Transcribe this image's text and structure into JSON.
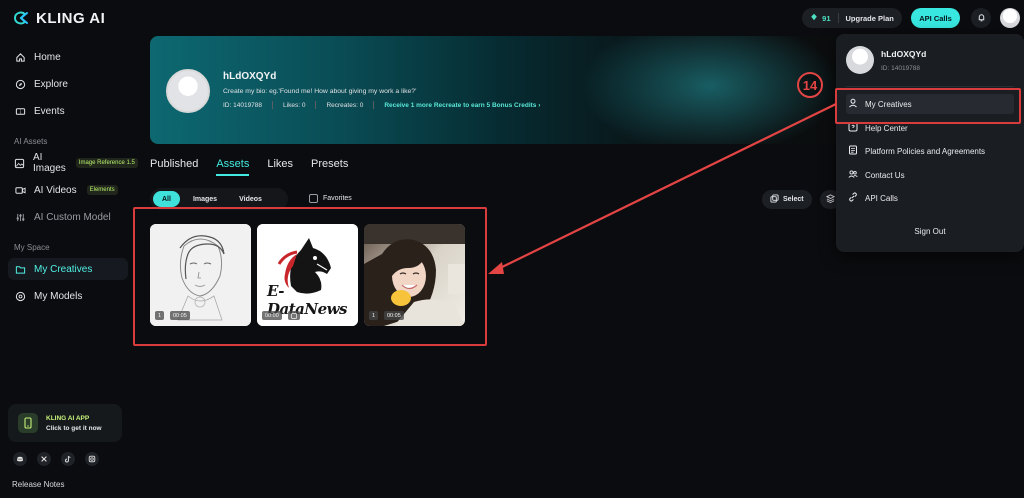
{
  "brand": {
    "name": "KLING AI"
  },
  "sidebar": {
    "items": [
      {
        "label": "Home",
        "icon": "home-icon"
      },
      {
        "label": "Explore",
        "icon": "compass-icon"
      },
      {
        "label": "Events",
        "icon": "ticket-icon"
      }
    ],
    "ai_assets_label": "AI Assets",
    "ai_items": [
      {
        "label": "AI Images",
        "tag": "Image Reference 1.5"
      },
      {
        "label": "AI Videos",
        "tag": "Elements"
      },
      {
        "label": "AI Custom Model",
        "tag": ""
      }
    ],
    "my_space_label": "My Space",
    "space_items": [
      {
        "label": "My Creatives",
        "active": true
      },
      {
        "label": "My Models",
        "active": false
      }
    ],
    "app_card": {
      "title": "KLING AI APP",
      "subtitle": "Click to get it now"
    },
    "release_notes": "Release Notes"
  },
  "topbar": {
    "credits": "91",
    "upgrade_label": "Upgrade Plan",
    "api_calls_label": "API Calls"
  },
  "profile": {
    "name": "hLdOXQYd",
    "bio": "Create my bio: eg.'Found me! How about giving my work a like?'",
    "id_text": "ID: 14019788",
    "likes_text": "Likes: 0",
    "recreates_text": "Recreates: 0",
    "promo_text": "Receive 1 more Recreate to earn 5 Bonus Credits"
  },
  "tabs": [
    {
      "label": "Published",
      "active": false
    },
    {
      "label": "Assets",
      "active": true
    },
    {
      "label": "Likes",
      "active": false
    },
    {
      "label": "Presets",
      "active": false
    }
  ],
  "filters": {
    "chips": [
      "All",
      "Images",
      "Videos"
    ],
    "active": "All",
    "favorites_label": "Favorites",
    "select_label": "Select"
  },
  "assets": [
    {
      "count": "1",
      "duration": "00:05",
      "kind": "sketch-portrait"
    },
    {
      "count": "",
      "duration": "00:00",
      "kind": "horse-logo",
      "logo_text": "E-DataNews"
    },
    {
      "count": "1",
      "duration": "00:05",
      "kind": "photo-portrait"
    }
  ],
  "dropdown": {
    "name": "hLdOXQYd",
    "id_text": "ID: 14019788",
    "items": [
      {
        "label": "My Creatives",
        "icon": "user-icon"
      },
      {
        "label": "Help Center",
        "icon": "help-icon"
      },
      {
        "label": "Platform Policies and Agreements",
        "icon": "document-icon"
      },
      {
        "label": "Contact Us",
        "icon": "contacts-icon"
      },
      {
        "label": "API Calls",
        "icon": "link-icon"
      }
    ],
    "sign_out": "Sign Out"
  },
  "annotation": {
    "marker": "14",
    "color": "#e34444"
  },
  "colors": {
    "accent": "#43ebe0",
    "background": "#0b0c0f",
    "highlight_frame": "#d93c3c"
  }
}
